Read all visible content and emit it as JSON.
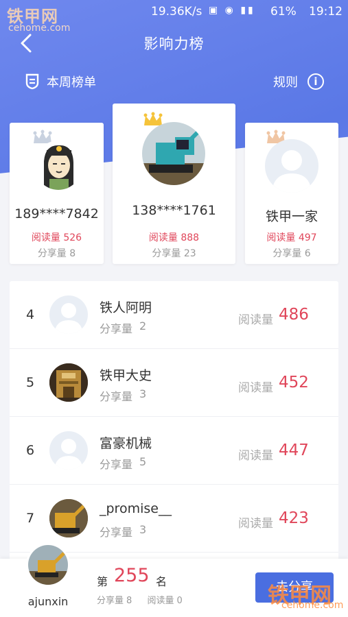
{
  "status_bar": {
    "watermark": "铁甲网",
    "watermark_url": "cehome.com",
    "speed": "19.36K/s",
    "battery": "61%",
    "time": "19:12"
  },
  "header": {
    "back_icon": "chevron-left-icon",
    "title": "影响力榜",
    "weekly_label": "本周榜单",
    "rules_label": "规则"
  },
  "podium": [
    {
      "position": 2,
      "name": "189****7842",
      "reads_label": "阅读量",
      "reads": "526",
      "shares_label": "分享量",
      "shares": "8",
      "crown_color": "#c9d2e0"
    },
    {
      "position": 1,
      "name": "138****1761",
      "reads_label": "阅读量",
      "reads": "888",
      "shares_label": "分享量",
      "shares": "23",
      "crown_color": "#f5c33a"
    },
    {
      "position": 3,
      "name": "铁甲一家",
      "reads_label": "阅读量",
      "reads": "497",
      "shares_label": "分享量",
      "shares": "6",
      "crown_color": "#f0c6a4"
    }
  ],
  "ranking": [
    {
      "rank": "4",
      "name": "铁人阿明",
      "share_label": "分享量",
      "shares": "2",
      "read_label": "阅读量",
      "reads": "486"
    },
    {
      "rank": "5",
      "name": "铁甲大史",
      "share_label": "分享量",
      "shares": "3",
      "read_label": "阅读量",
      "reads": "452"
    },
    {
      "rank": "6",
      "name": "富豪机械",
      "share_label": "分享量",
      "shares": "5",
      "read_label": "阅读量",
      "reads": "447"
    },
    {
      "rank": "7",
      "name": "_promise__",
      "share_label": "分享量",
      "shares": "3",
      "read_label": "阅读量",
      "reads": "423"
    }
  ],
  "me": {
    "name": "ajunxin",
    "rank_prefix": "第",
    "rank": "255",
    "rank_suffix": "名",
    "share_label": "分享量",
    "shares": "8",
    "read_label": "阅读量",
    "reads": "0",
    "button_label": "去分享",
    "watermark": "铁甲网",
    "watermark_url": "cehome.com"
  },
  "colors": {
    "accent": "#5a78e6",
    "highlight": "#e0465a",
    "button": "#4a6ee0"
  }
}
